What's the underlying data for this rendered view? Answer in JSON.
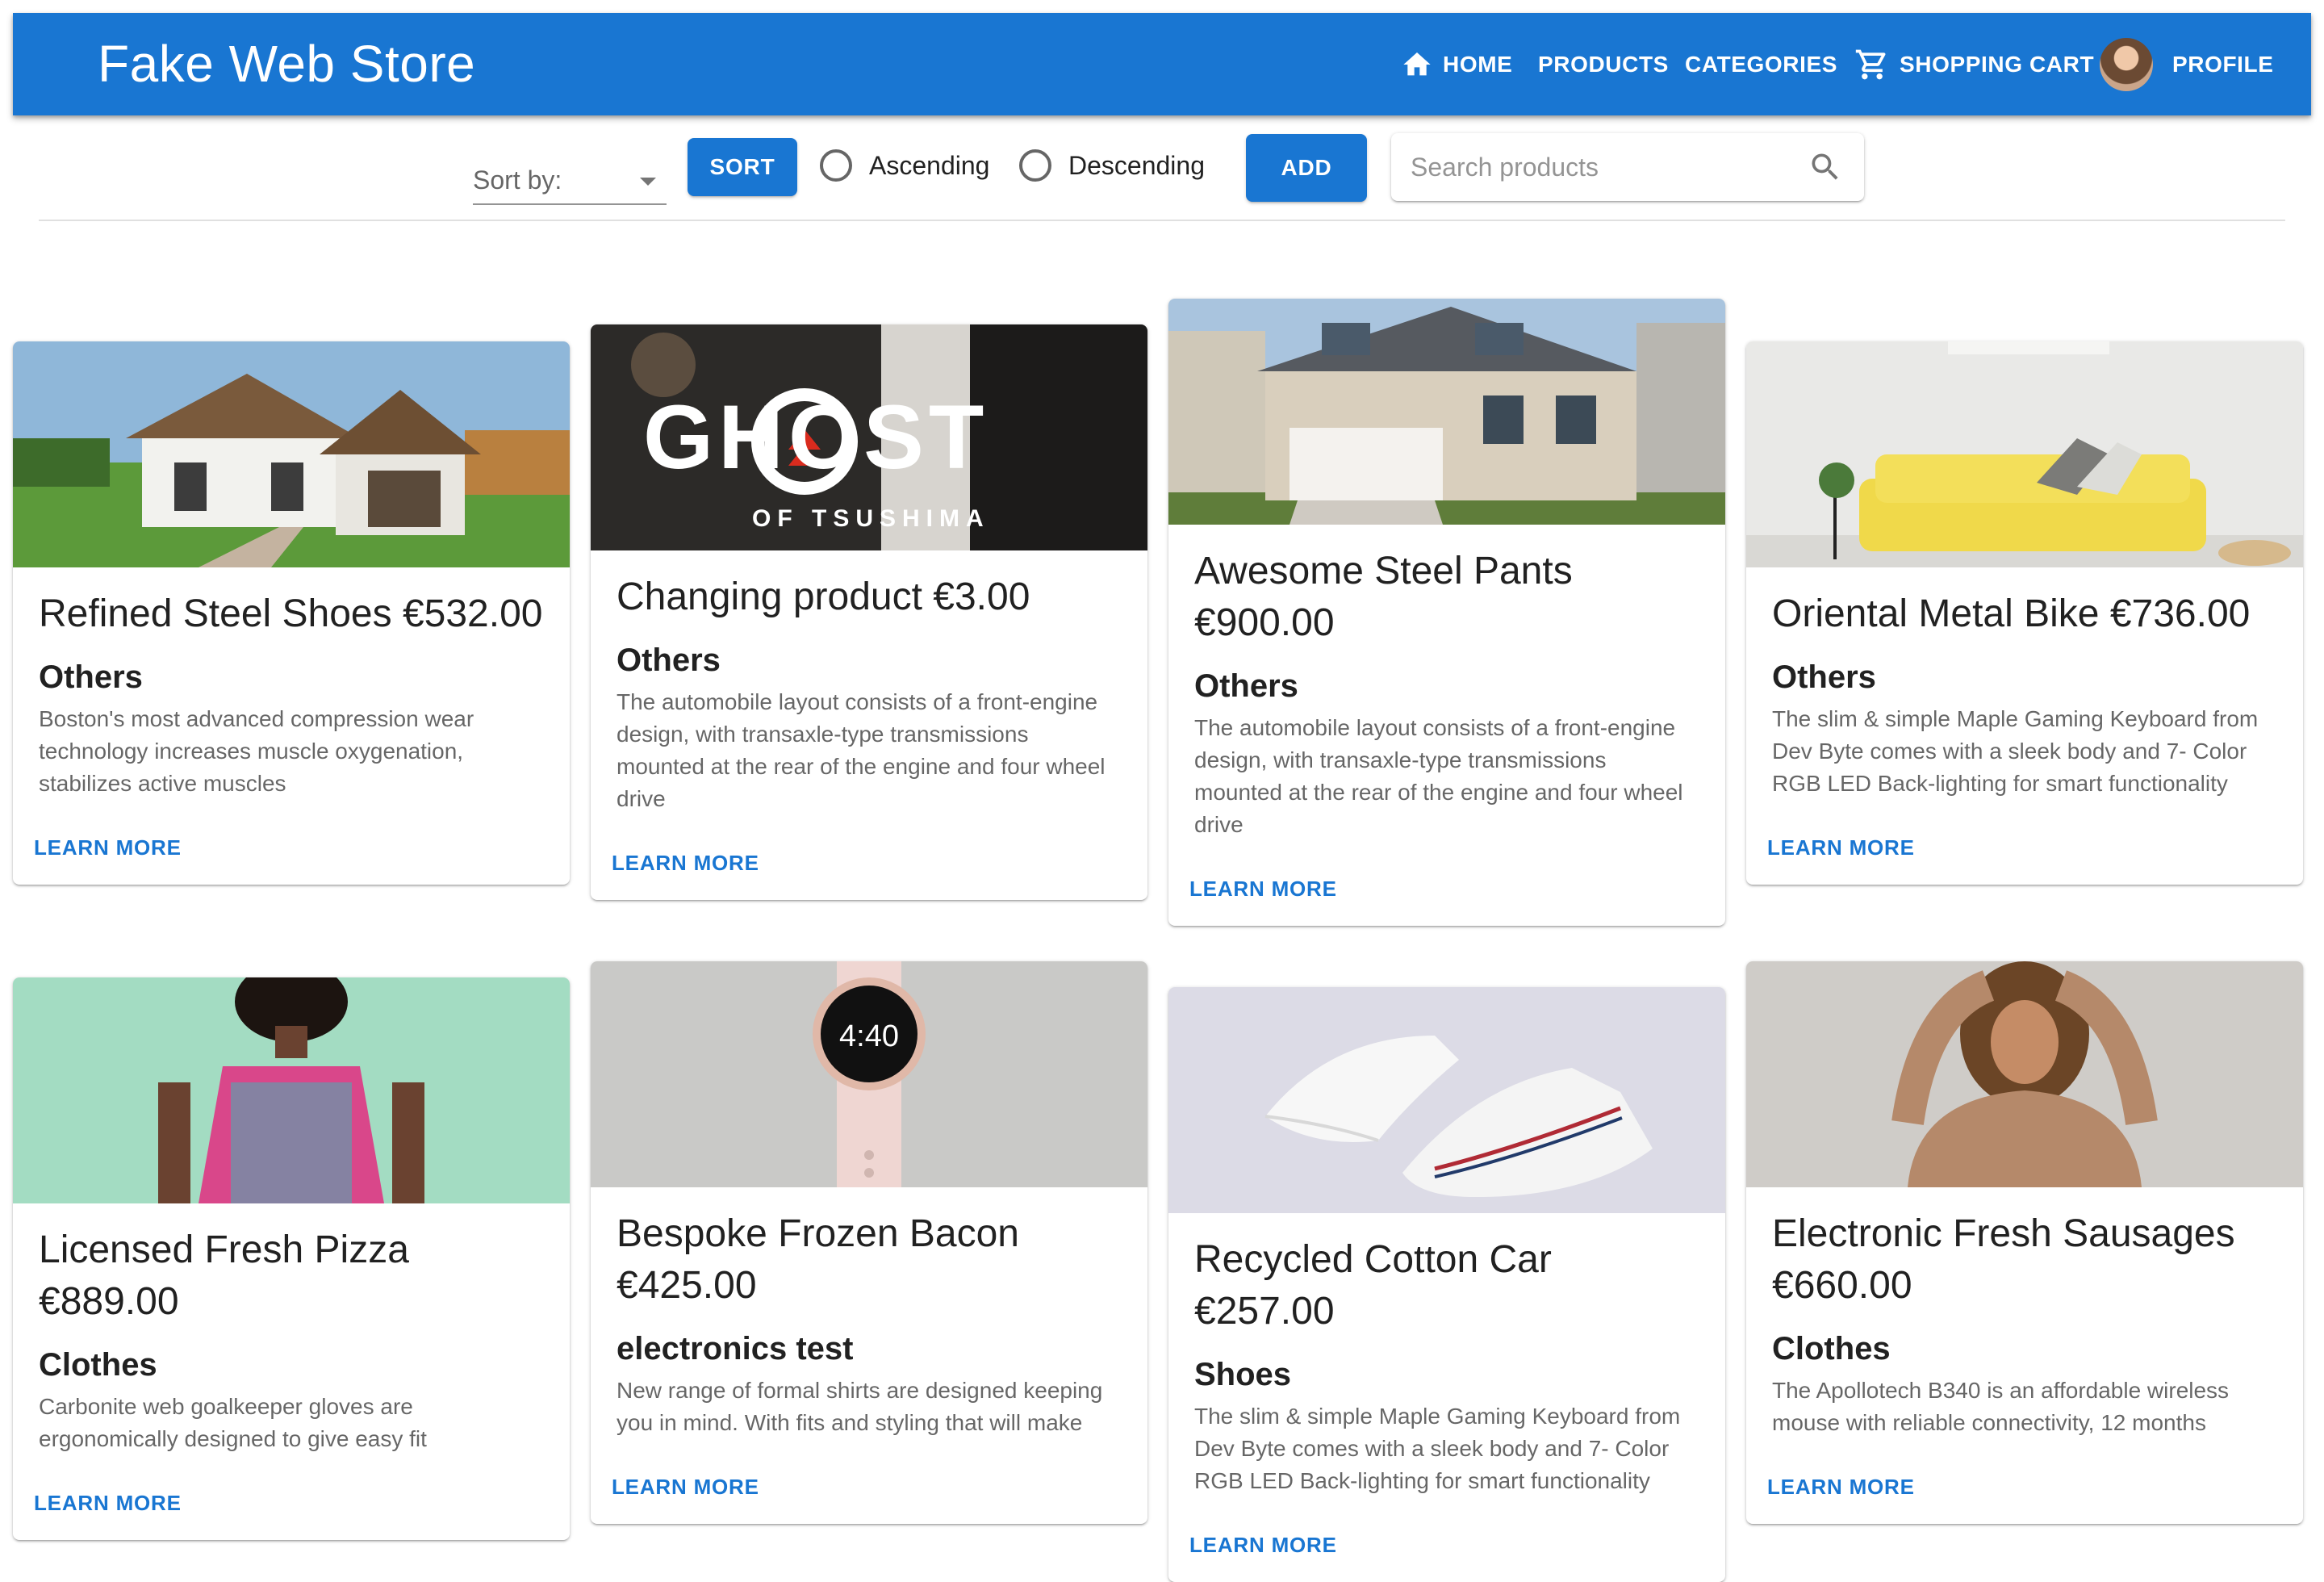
{
  "header": {
    "brand": "Fake Web Store",
    "nav": {
      "home": "HOME",
      "products": "PRODUCTS",
      "categories": "CATEGORIES",
      "cart": "SHOPPING CART",
      "profile": "PROFILE"
    }
  },
  "toolbar": {
    "sort_label": "Sort by:",
    "sort_button": "SORT",
    "ascending": "Ascending",
    "descending": "Descending",
    "add_button": "ADD",
    "search_placeholder": "Search products"
  },
  "products": [
    {
      "title": "Refined Steel Shoes €532.00",
      "category": "Others",
      "description": "Boston's most advanced compression wear technology increases muscle oxygenation, stabilizes active muscles",
      "action": "LEARN MORE",
      "image": "house"
    },
    {
      "title": "Changing product €3.00",
      "category": "Others",
      "description": "The automobile layout consists of a front-engine design, with transaxle-type transmissions mounted at the rear of the engine and four wheel drive",
      "action": "LEARN MORE",
      "image": "ghost-of-tsushima",
      "image_text": "GHOST",
      "image_subtext": "OF TSUSHIMA"
    },
    {
      "title": "Awesome Steel Pants €900.00",
      "category": "Others",
      "description": "The automobile layout consists of a front-engine design, with transaxle-type transmissions mounted at the rear of the engine and four wheel drive",
      "action": "LEARN MORE",
      "image": "suburban-house"
    },
    {
      "title": "Oriental Metal Bike €736.00",
      "category": "Others",
      "description": "The slim & simple Maple Gaming Keyboard from Dev Byte comes with a sleek body and 7- Color RGB LED Back-lighting for smart functionality",
      "action": "LEARN MORE",
      "image": "yellow-sofa"
    },
    {
      "title": "Licensed Fresh Pizza €889.00",
      "category": "Clothes",
      "description": "Carbonite web goalkeeper gloves are ergonomically designed to give easy fit",
      "action": "LEARN MORE",
      "image": "woman-dress"
    },
    {
      "title": "Bespoke Frozen Bacon €425.00",
      "category": "electronics test",
      "description": "New range of formal shirts are designed keeping you in mind. With fits and styling that will make",
      "action": "LEARN MORE",
      "image": "smartwatch",
      "image_text": "4:40"
    },
    {
      "title": "Recycled Cotton Car €257.00",
      "category": "Shoes",
      "description": "The slim & simple Maple Gaming Keyboard from Dev Byte comes with a sleek body and 7- Color RGB LED Back-lighting for smart functionality",
      "action": "LEARN MORE",
      "image": "sneakers"
    },
    {
      "title": "Electronic Fresh Sausages €660.00",
      "category": "Clothes",
      "description": "The Apollotech B340 is an affordable wireless mouse with reliable connectivity, 12 months",
      "action": "LEARN MORE",
      "image": "woman-sweater"
    }
  ],
  "colors": {
    "primary": "#1976d2"
  }
}
